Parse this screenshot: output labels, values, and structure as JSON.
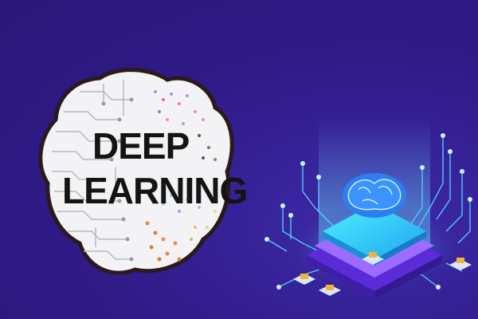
{
  "illustration": {
    "title_line1": "DEEP",
    "title_line2": "LEARNING",
    "left_graphic": "brain-icon",
    "right_graphic": "ai-chip-icon"
  },
  "colors": {
    "background": "#2f1a86",
    "brain_outline": "#2a1a1a",
    "brain_fill": "#f3f3f6",
    "chip_glow": "#38d6ff",
    "chip_base": "#7a3df0"
  }
}
